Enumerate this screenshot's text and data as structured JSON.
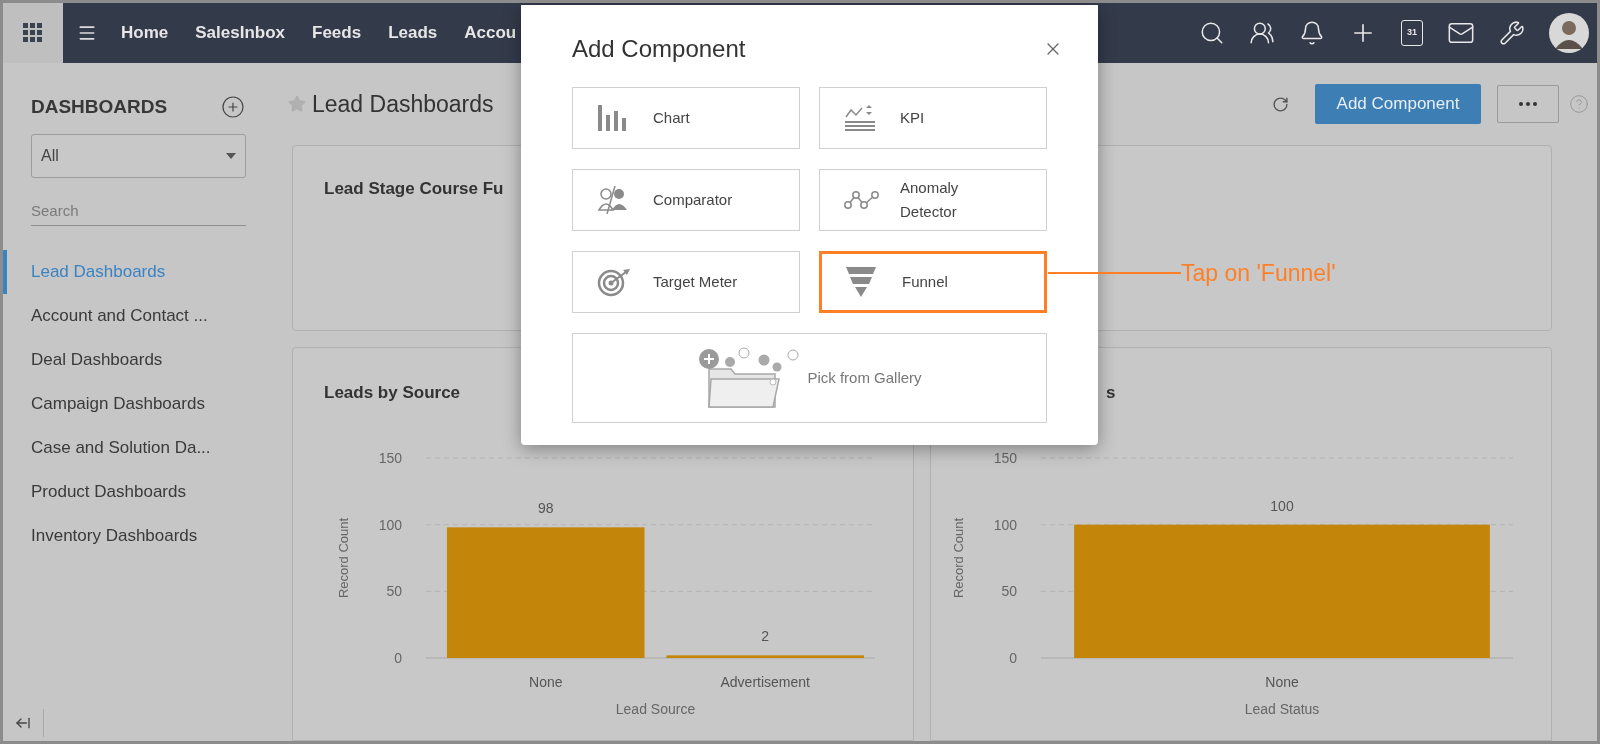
{
  "nav": {
    "items": [
      {
        "label": "Home"
      },
      {
        "label": "SalesInbox"
      },
      {
        "label": "Feeds"
      },
      {
        "label": "Leads"
      },
      {
        "label": "Accou"
      }
    ],
    "calendar_day": "31"
  },
  "sidebar": {
    "title": "DASHBOARDS",
    "filter": "All",
    "search": {
      "placeholder": "Search"
    },
    "items": [
      {
        "label": "Lead Dashboards",
        "selected": true
      },
      {
        "label": "Account and Contact ...",
        "selected": false
      },
      {
        "label": "Deal Dashboards",
        "selected": false
      },
      {
        "label": "Campaign Dashboards",
        "selected": false
      },
      {
        "label": "Case and Solution Da...",
        "selected": false
      },
      {
        "label": "Product Dashboards",
        "selected": false
      },
      {
        "label": "Inventory Dashboards",
        "selected": false
      }
    ]
  },
  "main": {
    "title": "Lead Dashboards",
    "add_button": "Add Component",
    "top_card": {
      "title": "Lead Stage Course Fu"
    },
    "chart_cards": [
      {
        "title": "Leads by Source",
        "chart_data": {
          "type": "bar",
          "xlabel": "Lead Source",
          "ylabel": "Record Count",
          "categories": [
            "None",
            "Advertisement"
          ],
          "series": [
            {
              "color": "#c4860a",
              "values": [
                98,
                2
              ]
            }
          ],
          "ylim": [
            0,
            150
          ],
          "yticks": [
            0,
            50,
            100,
            150
          ],
          "data_labels": true
        }
      },
      {
        "title": "s",
        "chart_data": {
          "type": "bar",
          "xlabel": "Lead Status",
          "ylabel": "Record Count",
          "categories": [
            "None"
          ],
          "series": [
            {
              "color": "#c4860a",
              "values": [
                100
              ]
            }
          ],
          "ylim": [
            0,
            150
          ],
          "yticks": [
            0,
            50,
            100,
            150
          ],
          "data_labels": true
        }
      }
    ]
  },
  "modal": {
    "title": "Add Component",
    "components": [
      {
        "kind": "chart",
        "label": "Chart",
        "highlighted": false
      },
      {
        "kind": "kpi",
        "label": "KPI",
        "highlighted": false
      },
      {
        "kind": "comparator",
        "label": "Comparator",
        "highlighted": false
      },
      {
        "kind": "anomaly",
        "label": "Anomaly Detector",
        "highlighted": false
      },
      {
        "kind": "target",
        "label": "Target Meter",
        "highlighted": false
      },
      {
        "kind": "funnel",
        "label": "Funnel",
        "highlighted": true
      },
      {
        "kind": "gallery",
        "label": "Pick from Gallery",
        "highlighted": false
      }
    ]
  },
  "annotation": {
    "callout": "Tap on 'Funnel'"
  }
}
